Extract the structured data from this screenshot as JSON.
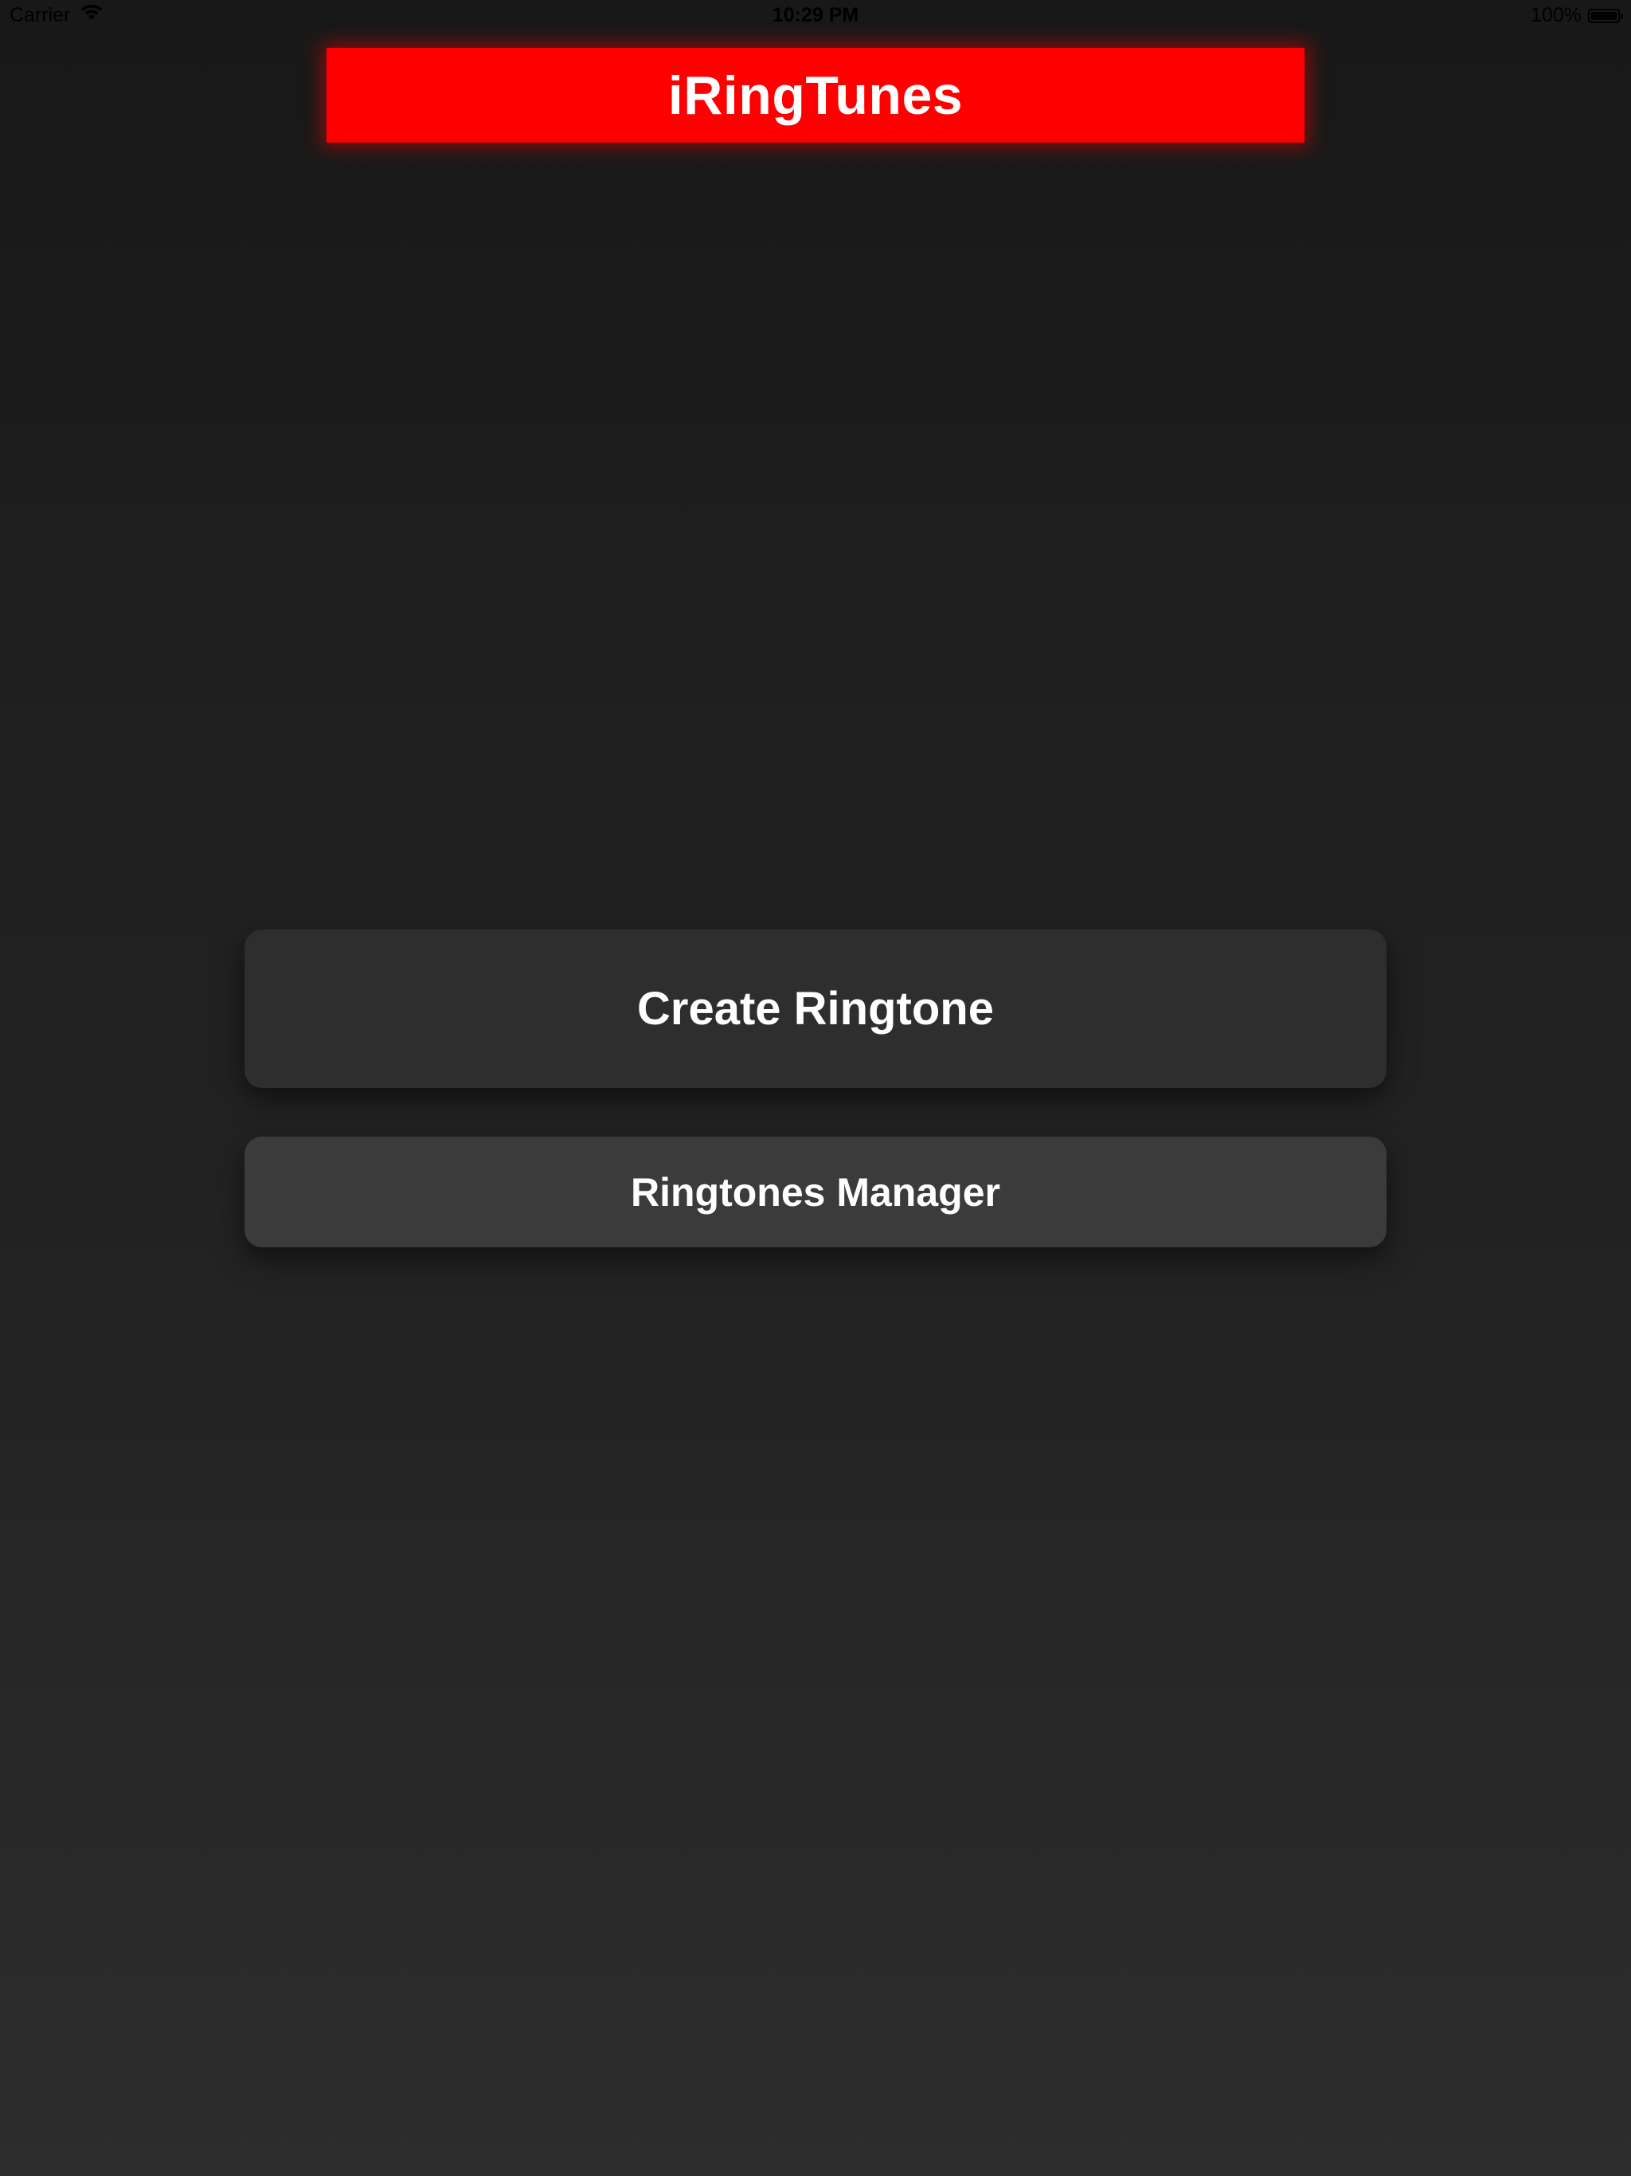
{
  "status_bar": {
    "carrier": "Carrier",
    "time": "10:29 PM",
    "battery": "100%"
  },
  "header": {
    "title": "iRingTunes",
    "color": "#ff0000"
  },
  "main": {
    "create_label": "Create Ringtone",
    "manager_label": "Ringtones Manager"
  },
  "icons": {
    "wifi": "wifi-icon",
    "battery": "battery-icon"
  }
}
